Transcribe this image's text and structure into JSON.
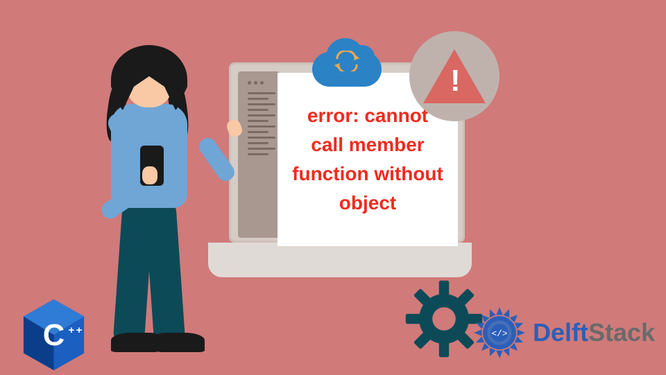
{
  "error_message": "error: cannot call member function without object",
  "brand": {
    "name_part1": "Delft",
    "name_part2": "Stack"
  },
  "badge": {
    "language": "C++"
  },
  "icons": {
    "cloud": "cloud-sync-icon",
    "warning": "warning-icon",
    "gear": "gear-icon",
    "person": "person-illustration",
    "laptop": "laptop-illustration"
  },
  "colors": {
    "background": "#d07a7a",
    "error_text": "#f02b1d",
    "accent_blue": "#2b5fb8",
    "cloud": "#2b83c6",
    "gear": "#0d4a57",
    "warn": "#d96762"
  }
}
